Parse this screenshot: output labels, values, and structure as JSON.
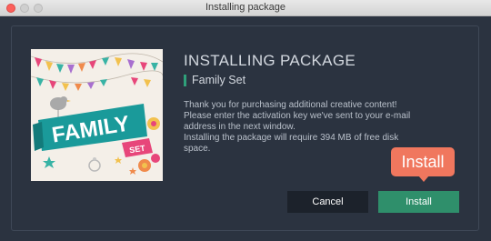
{
  "window": {
    "title": "Installing package"
  },
  "main": {
    "heading": "INSTALLING PACKAGE",
    "package_name": "Family Set",
    "description_lines": [
      "Thank you for purchasing additional creative content!",
      "Please enter the activation key we've sent to your e-mail",
      "address in the next window.",
      "Installing the package will require 394 MB of free disk",
      "space."
    ],
    "thumbnail": {
      "banner_word": "FAMILY",
      "tag_word": "SET"
    }
  },
  "buttons": {
    "cancel": "Cancel",
    "install": "Install"
  },
  "callout": {
    "label": "Install"
  },
  "colors": {
    "window_bg": "#2b3340",
    "accent": "#2f8f6b",
    "callout": "#f0775e",
    "banner": "#1a9a9a",
    "tag": "#e7467a"
  }
}
